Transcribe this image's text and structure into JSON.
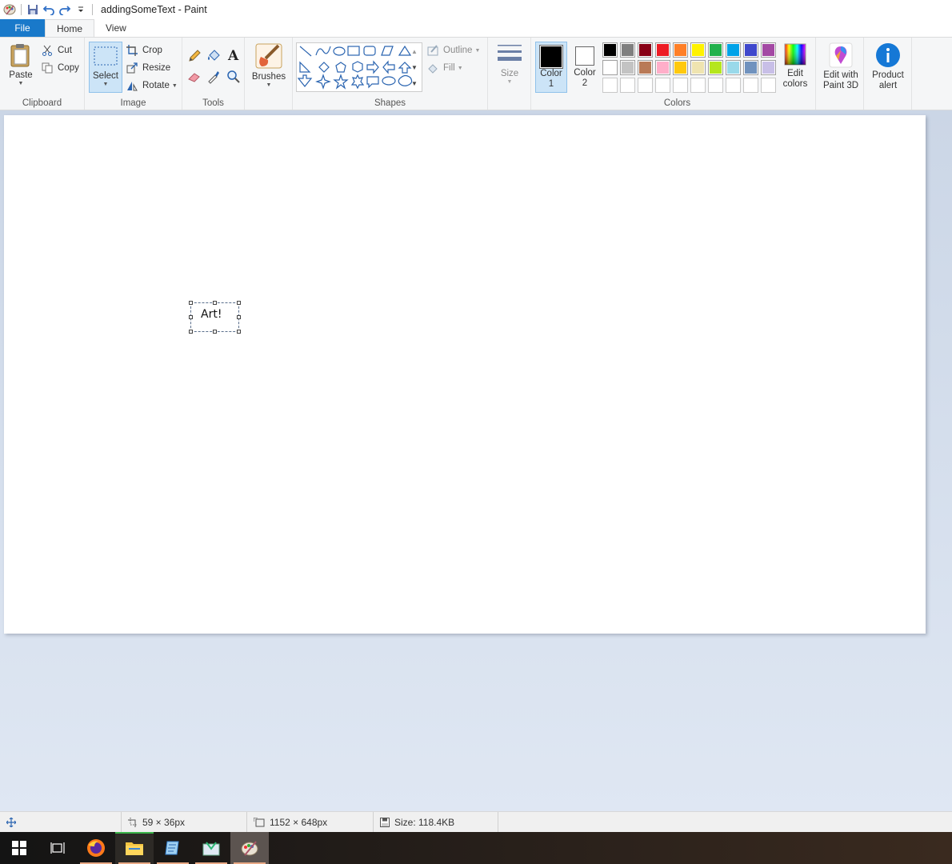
{
  "window": {
    "title": "addingSomeText - Paint"
  },
  "tabs": [
    {
      "label": "File"
    },
    {
      "label": "Home"
    },
    {
      "label": "View"
    }
  ],
  "ribbon": {
    "clipboard": {
      "group": "Clipboard",
      "paste": "Paste",
      "cut": "Cut",
      "copy": "Copy"
    },
    "image": {
      "group": "Image",
      "select": "Select",
      "crop": "Crop",
      "resize": "Resize",
      "rotate": "Rotate"
    },
    "tools": {
      "group": "Tools"
    },
    "brushes": {
      "label": "Brushes"
    },
    "shapes": {
      "group": "Shapes",
      "outline": "Outline",
      "fill": "Fill"
    },
    "size": {
      "label": "Size"
    },
    "colors": {
      "group": "Colors",
      "color1": [
        "Color",
        "1"
      ],
      "color2": [
        "Color",
        "2"
      ],
      "color1_value": "#000000",
      "color2_value": "#ffffff",
      "palette_row1": [
        "#000000",
        "#7f7f7f",
        "#880015",
        "#ed1c24",
        "#ff7f27",
        "#fff200",
        "#22b14c",
        "#00a2e8",
        "#3f48cc",
        "#a349a4"
      ],
      "palette_row2": [
        "#ffffff",
        "#c3c3c3",
        "#b97a57",
        "#ffaec9",
        "#ffc90e",
        "#efe4b0",
        "#b5e61d",
        "#99d9ea",
        "#7092be",
        "#c8bfe7"
      ],
      "palette_row3": [
        "#ffffff",
        "#ffffff",
        "#ffffff",
        "#ffffff",
        "#ffffff",
        "#ffffff",
        "#ffffff",
        "#ffffff",
        "#ffffff",
        "#ffffff"
      ],
      "edit_colors": [
        "Edit",
        "colors"
      ],
      "edit_paint3d": [
        "Edit with",
        "Paint 3D"
      ],
      "product_alert": [
        "Product",
        "alert"
      ]
    }
  },
  "canvas": {
    "text": "Art!"
  },
  "status": {
    "selection_size": "59 × 36px",
    "image_size": "1152 × 648px",
    "file_size": "Size: 118.4KB"
  }
}
